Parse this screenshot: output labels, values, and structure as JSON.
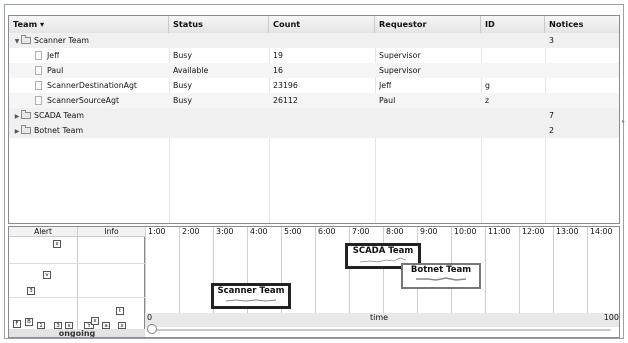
{
  "grid": {
    "columns": [
      {
        "label": "Team ▾",
        "key": "team"
      },
      {
        "label": "Status",
        "key": "status"
      },
      {
        "label": "Count",
        "key": "count"
      },
      {
        "label": "Requestor",
        "key": "requestor"
      },
      {
        "label": "ID",
        "key": "id"
      },
      {
        "label": "Notices",
        "key": "notices"
      }
    ],
    "rows": [
      {
        "kind": "group",
        "expanded": true,
        "name": "Scanner Team",
        "status": "",
        "count": "",
        "requestor": "",
        "id": "",
        "notices": "3"
      },
      {
        "kind": "item",
        "name": "Jeff",
        "status": "Busy",
        "count": "19",
        "requestor": "Supervisor",
        "id": "",
        "notices": ""
      },
      {
        "kind": "item",
        "name": "Paul",
        "status": "Available",
        "count": "16",
        "requestor": "Supervisor",
        "id": "",
        "notices": ""
      },
      {
        "kind": "item",
        "name": "ScannerDestinationAgt",
        "status": "Busy",
        "count": "23196",
        "requestor": "Jeff",
        "id": "g",
        "notices": ""
      },
      {
        "kind": "item",
        "name": "ScannerSourceAgt",
        "status": "Busy",
        "count": "26112",
        "requestor": "Paul",
        "id": "z",
        "notices": ""
      },
      {
        "kind": "group",
        "expanded": false,
        "name": "SCADA Team",
        "status": "",
        "count": "",
        "requestor": "",
        "id": "",
        "notices": "7"
      },
      {
        "kind": "group",
        "expanded": false,
        "name": "Botnet Team",
        "status": "",
        "count": "",
        "requestor": "",
        "id": "",
        "notices": "2"
      }
    ]
  },
  "alert_info": {
    "alert_label": "Alert",
    "info_label": "Info",
    "ongoing_label": "ongoing",
    "boxes": [
      "x",
      "v",
      "3",
      "t",
      "F",
      "B",
      "1",
      "3",
      "Y",
      "x",
      "a",
      "x",
      "x"
    ]
  },
  "timeline": {
    "ticks": [
      "1:00",
      "2:00",
      "3:00",
      "4:00",
      "5:00",
      "6:00",
      "7:00",
      "8:00",
      "9:00",
      "10:00",
      "11:00",
      "12:00",
      "13:00",
      "14:00"
    ],
    "axis_label": "time",
    "axis_min": "0",
    "axis_max": "100",
    "slider_value": 0,
    "teams": [
      {
        "name": "SCADA Team"
      },
      {
        "name": "Botnet Team"
      },
      {
        "name": "Scanner Team"
      }
    ]
  }
}
